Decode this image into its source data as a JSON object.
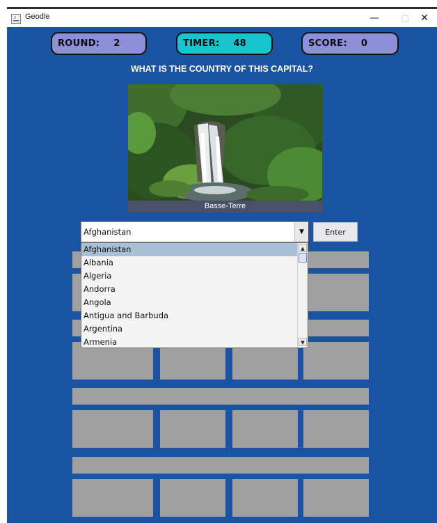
{
  "window": {
    "title": "Geodle",
    "minimize": "—",
    "maximize": "□",
    "close": "✕"
  },
  "stats": {
    "round_label": "ROUND:",
    "round_value": "2",
    "timer_label": "TIMER:",
    "timer_value": "48",
    "score_label": "SCORE:",
    "score_value": "0"
  },
  "question": "WHAT IS THE COUNTRY OF THIS CAPITAL?",
  "capital": {
    "caption": "Basse-Terre"
  },
  "combo": {
    "selected": "Afghanistan",
    "arrow": "▼"
  },
  "enter_label": "Enter",
  "dropdown": {
    "options": [
      "Afghanistan",
      "Albania",
      "Algeria",
      "Andorra",
      "Angola",
      "Antigua and Barbuda",
      "Argentina",
      "Armenia"
    ],
    "highlighted_index": 0,
    "scroll_up": "▲",
    "scroll_down": "▼"
  },
  "colors": {
    "panel_bg": "#1a53a1",
    "round_pill": "#8e8fd9",
    "timer_pill": "#19c4cf",
    "score_pill": "#8e8fd9",
    "tile_gray": "#a0a0a0"
  }
}
